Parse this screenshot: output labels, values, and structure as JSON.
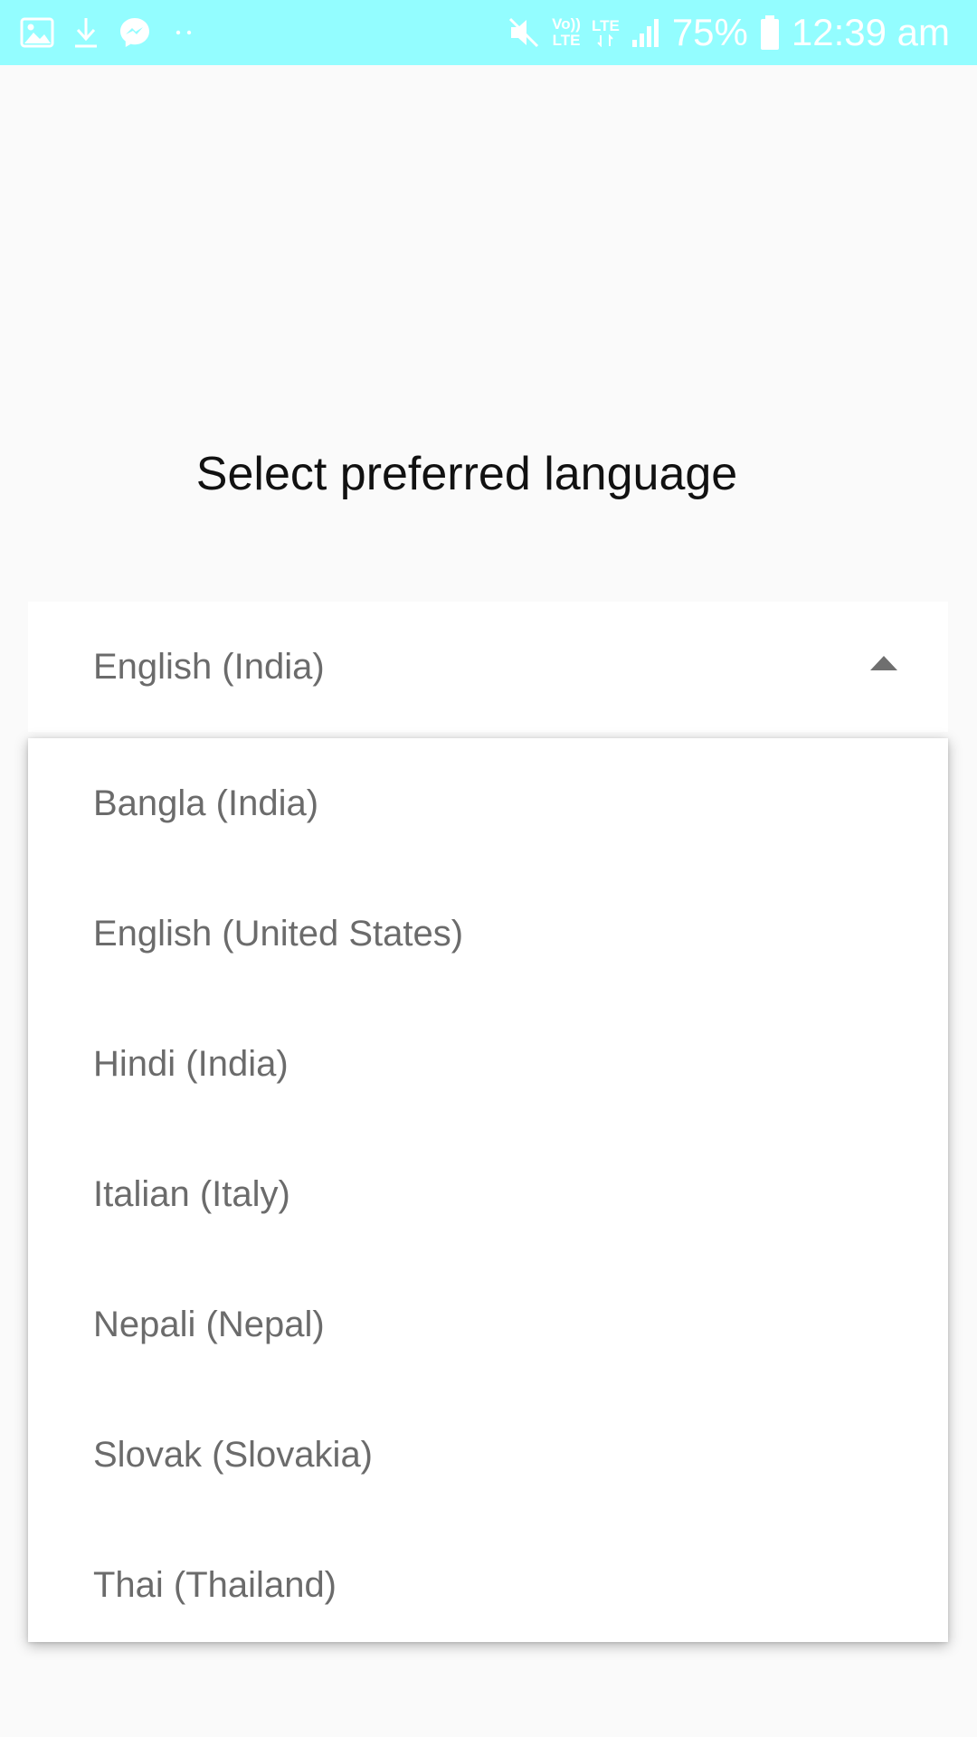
{
  "status_bar": {
    "background": "#93fdff",
    "left_icons": [
      "gallery-icon",
      "download-icon",
      "messenger-icon",
      "more-dots-icon"
    ],
    "right_icons": [
      "mute-icon",
      "volte-icon",
      "lte-icon",
      "signal-icon",
      "battery-icon"
    ],
    "volte_top": "Vo))",
    "volte_bottom": "LTE",
    "lte_label": "LTE",
    "battery_percent": "75%",
    "time": "12:39 am"
  },
  "page": {
    "title": "Select preferred language"
  },
  "language_spinner": {
    "selected": "English (India)",
    "arrow_icon": "arrow-up-icon",
    "expanded": true
  },
  "dropdown": {
    "options": [
      "Bangla (India)",
      "English (United States)",
      "Hindi (India)",
      "Italian (Italy)",
      "Nepali (Nepal)",
      "Slovak (Slovakia)",
      "Thai (Thailand)"
    ]
  }
}
